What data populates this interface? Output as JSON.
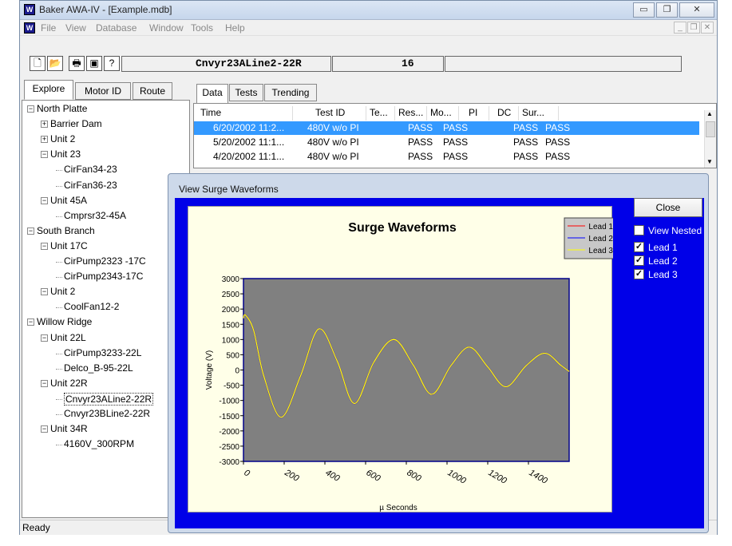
{
  "window": {
    "title": "Baker AWA-IV - [Example.mdb]",
    "icon": "awa-app-icon",
    "caption_buttons": [
      "minimize",
      "restore",
      "close"
    ]
  },
  "menu": [
    "File",
    "View",
    "Database",
    "Window",
    "Tools",
    "Help"
  ],
  "toolbar": {
    "icons": [
      "new-icon",
      "open-icon",
      "print-icon",
      "print-setup-icon",
      "help-icon"
    ],
    "motor_field": "Cnvyr23ALine2-22R",
    "count_field": "16"
  },
  "left_tabs": [
    "Explore",
    "Motor ID",
    "Route"
  ],
  "tree": [
    {
      "label": "North Platte",
      "level": 0,
      "expander": "minus"
    },
    {
      "label": "Barrier Dam",
      "level": 1,
      "expander": "plus"
    },
    {
      "label": "Unit 2",
      "level": 1,
      "expander": "plus"
    },
    {
      "label": "Unit 23",
      "level": 1,
      "expander": "minus"
    },
    {
      "label": "CirFan34-23",
      "level": 2,
      "expander": ""
    },
    {
      "label": "CirFan36-23",
      "level": 2,
      "expander": ""
    },
    {
      "label": "Unit 45A",
      "level": 1,
      "expander": "minus"
    },
    {
      "label": "Cmprsr32-45A",
      "level": 2,
      "expander": ""
    },
    {
      "label": "South Branch",
      "level": 0,
      "expander": "minus"
    },
    {
      "label": "Unit 17C",
      "level": 1,
      "expander": "minus"
    },
    {
      "label": "CirPump2323 -17C",
      "level": 2,
      "expander": ""
    },
    {
      "label": "CirPump2343-17C",
      "level": 2,
      "expander": ""
    },
    {
      "label": "Unit 2",
      "level": 1,
      "expander": "minus"
    },
    {
      "label": "CoolFan12-2",
      "level": 2,
      "expander": ""
    },
    {
      "label": "Willow Ridge",
      "level": 0,
      "expander": "minus"
    },
    {
      "label": "Unit 22L",
      "level": 1,
      "expander": "minus"
    },
    {
      "label": "CirPump3233-22L",
      "level": 2,
      "expander": ""
    },
    {
      "label": "Delco_B-95-22L",
      "level": 2,
      "expander": ""
    },
    {
      "label": "Unit 22R",
      "level": 1,
      "expander": "minus"
    },
    {
      "label": "Cnvyr23ALine2-22R",
      "level": 2,
      "expander": "",
      "selected": true
    },
    {
      "label": "Cnvyr23BLine2-22R",
      "level": 2,
      "expander": ""
    },
    {
      "label": "Unit 34R",
      "level": 1,
      "expander": "minus"
    },
    {
      "label": "4160V_300RPM",
      "level": 2,
      "expander": ""
    }
  ],
  "right_tabs": [
    "Data",
    "Tests",
    "Trending"
  ],
  "table": {
    "columns": [
      "Time",
      "Test ID",
      "Te...",
      "Res...",
      "Mo...",
      "PI",
      "DC",
      "Sur..."
    ],
    "rows": [
      [
        "6/20/2002 11:2...",
        "480V w/o PI",
        "",
        "PASS",
        "PASS",
        "",
        "PASS",
        "PASS"
      ],
      [
        "5/20/2002 11:1...",
        "480V w/o PI",
        "",
        "PASS",
        "PASS",
        "",
        "PASS",
        "PASS"
      ],
      [
        "4/20/2002 11:1...",
        "480V w/o PI",
        "",
        "PASS",
        "PASS",
        "",
        "PASS",
        "PASS"
      ]
    ]
  },
  "status": "Ready",
  "dialog": {
    "title": "View Surge Waveforms",
    "close_label": "Close",
    "view_nested_label": "View Nested",
    "view_nested_checked": false,
    "lead_checks": [
      {
        "label": "Lead 1",
        "checked": true
      },
      {
        "label": "Lead 2",
        "checked": true
      },
      {
        "label": "Lead 3",
        "checked": true
      }
    ],
    "colors": {
      "body": "#0000e8",
      "plot_bg": "#808080",
      "frame_bg": "#ffffe8"
    }
  },
  "chart_data": {
    "type": "line",
    "title": "Surge Waveforms",
    "xlabel": "µ Seconds",
    "ylabel": "Voltage (V)",
    "xlim": [
      0,
      1600
    ],
    "ylim": [
      -3000,
      3000
    ],
    "x_ticks": [
      0,
      200,
      400,
      600,
      800,
      1000,
      1200,
      1400
    ],
    "y_ticks": [
      3000,
      2500,
      2000,
      1500,
      1000,
      500,
      0,
      -500,
      -1000,
      -1500,
      -2000,
      -2500,
      -3000
    ],
    "legend": "top-right",
    "series": [
      {
        "name": "Lead 1",
        "color": "#ff0000",
        "x": [
          0,
          10,
          50,
          100,
          185,
          280,
          370,
          460,
          545,
          640,
          740,
          835,
          925,
          1020,
          1110,
          1200,
          1290,
          1390,
          1480,
          1560,
          1600
        ],
        "y": [
          1700,
          1800,
          1300,
          -200,
          -1550,
          -200,
          1350,
          300,
          -1100,
          250,
          1000,
          150,
          -800,
          150,
          750,
          100,
          -550,
          150,
          550,
          150,
          -50
        ]
      },
      {
        "name": "Lead 2",
        "color": "#0000ff",
        "x": [
          0,
          10,
          50,
          100,
          185,
          280,
          370,
          460,
          545,
          640,
          740,
          835,
          925,
          1020,
          1110,
          1200,
          1290,
          1390,
          1480,
          1560,
          1600
        ],
        "y": [
          1700,
          1800,
          1300,
          -200,
          -1550,
          -200,
          1350,
          300,
          -1100,
          250,
          1000,
          150,
          -800,
          150,
          750,
          100,
          -550,
          150,
          550,
          150,
          -50
        ]
      },
      {
        "name": "Lead 3",
        "color": "#ffff00",
        "x": [
          0,
          10,
          50,
          100,
          185,
          280,
          370,
          460,
          545,
          640,
          740,
          835,
          925,
          1020,
          1110,
          1200,
          1290,
          1390,
          1480,
          1560,
          1600
        ],
        "y": [
          1700,
          1800,
          1300,
          -200,
          -1550,
          -200,
          1350,
          300,
          -1100,
          250,
          1000,
          150,
          -800,
          150,
          750,
          100,
          -550,
          150,
          550,
          150,
          -50
        ]
      }
    ]
  }
}
